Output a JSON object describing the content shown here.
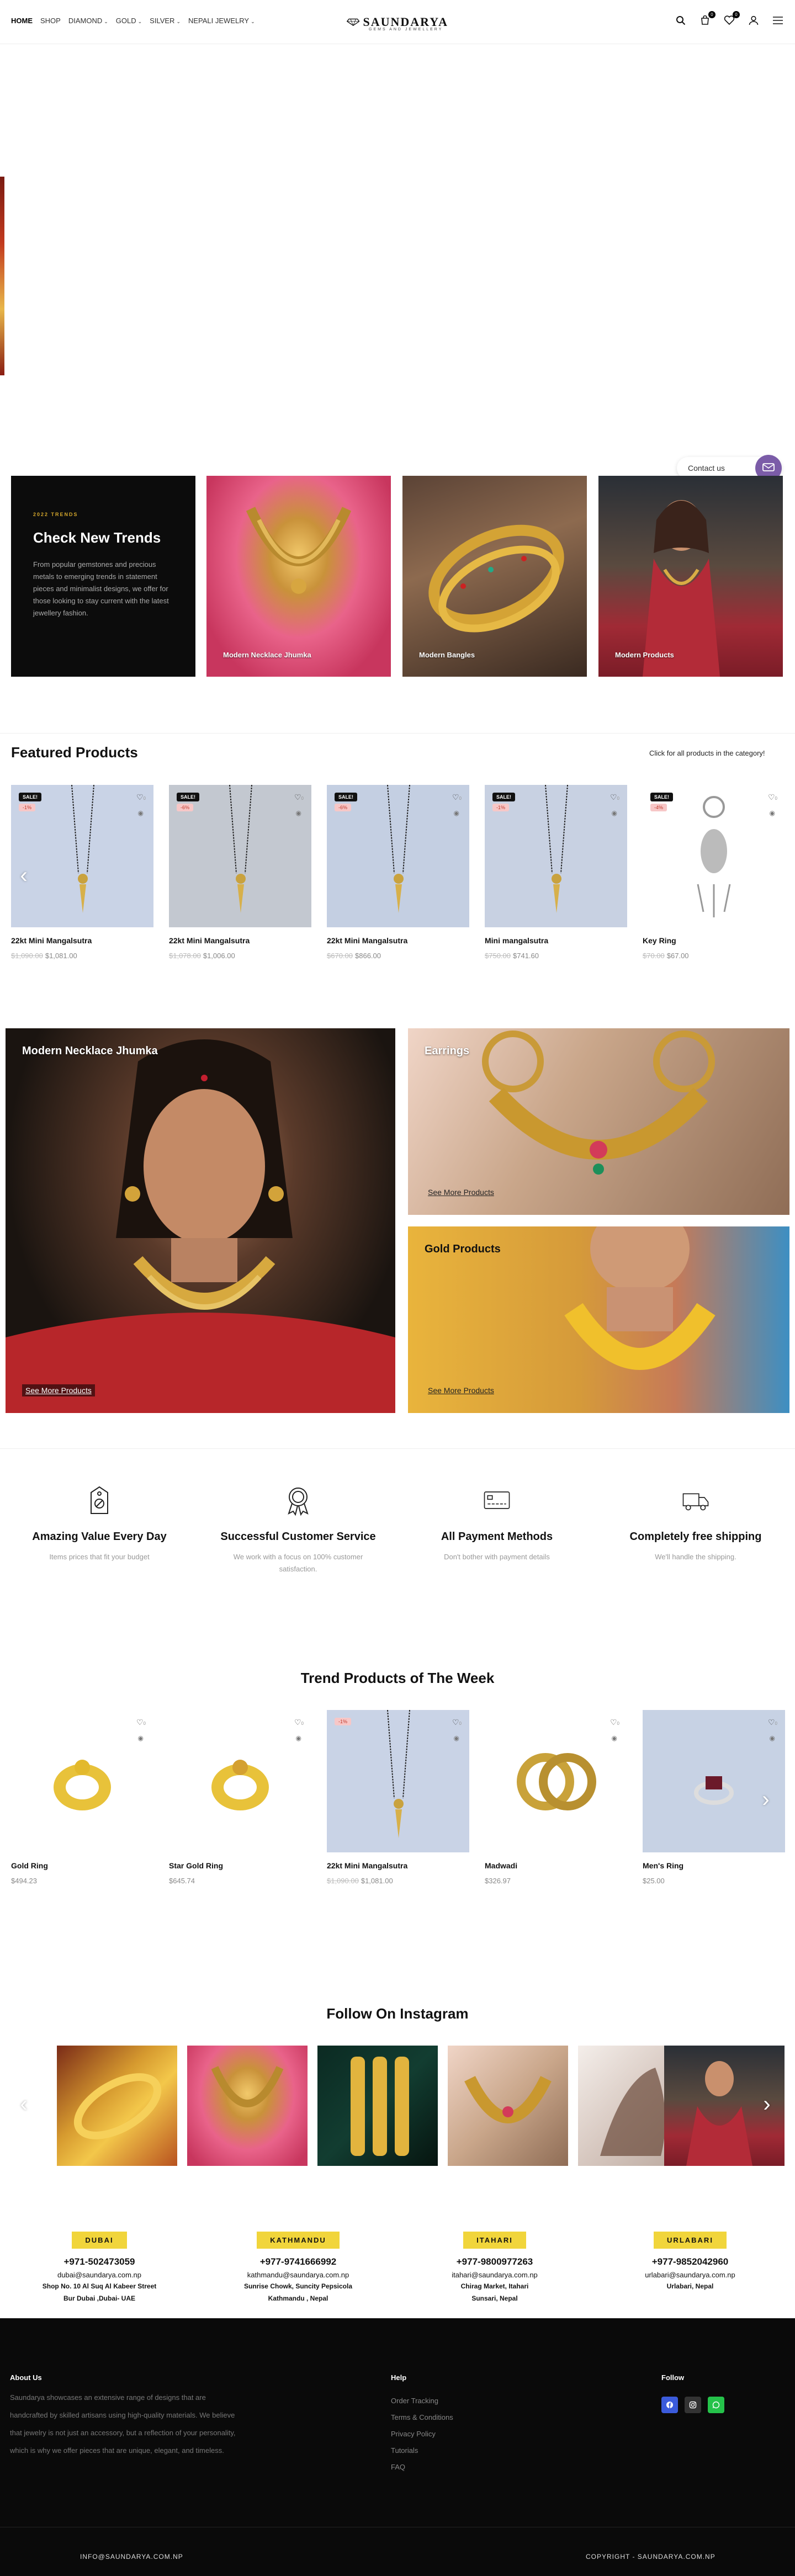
{
  "header": {
    "nav": [
      {
        "label": "HOME",
        "has_dropdown": false,
        "active": true
      },
      {
        "label": "SHOP",
        "has_dropdown": false
      },
      {
        "label": "DIAMOND",
        "has_dropdown": true
      },
      {
        "label": "GOLD",
        "has_dropdown": true
      },
      {
        "label": "SILVER",
        "has_dropdown": true
      },
      {
        "label": "NEPALI JEWELRY",
        "has_dropdown": true
      }
    ],
    "logo_name": "SAUNDARYA",
    "logo_tagline": "GEMS AND JEWELLERY",
    "cart_count": "0",
    "wishlist_count": "0"
  },
  "contact": {
    "label": "Contact us"
  },
  "trends": {
    "tag": "2022 TRENDS",
    "title": "Check New Trends",
    "text": "From popular gemstones and precious metals to emerging trends in statement pieces and minimalist designs, we offer for those looking to stay current with the latest jewellery fashion.",
    "cards": [
      "Modern Necklace Jhumka",
      "Modern Bangles",
      "Modern Products"
    ]
  },
  "featured": {
    "title": "Featured Products",
    "link_text": "Click for all products in the category!",
    "products": [
      {
        "name": "22kt Mini Mangalsutra",
        "old_price": "$1,090.00",
        "price": "$1,081.00",
        "sale": "SALE!",
        "discount": "-1%",
        "wish_count": "0"
      },
      {
        "name": "22kt Mini Mangalsutra",
        "old_price": "$1,078.00",
        "price": "$1,006.00",
        "sale": "SALE!",
        "discount": "-6%",
        "wish_count": "0"
      },
      {
        "name": "22kt Mini Mangalsutra",
        "old_price": "$670.00",
        "price": "$866.00",
        "sale": "SALE!",
        "discount": "-6%",
        "wish_count": "0"
      },
      {
        "name": "Mini mangalsutra",
        "old_price": "$750.00",
        "price": "$741.60",
        "sale": "SALE!",
        "discount": "-1%",
        "wish_count": "0"
      },
      {
        "name": "Key Ring",
        "old_price": "$70.00",
        "price": "$67.00",
        "sale": "SALE!",
        "discount": "-4%",
        "wish_count": "0"
      }
    ]
  },
  "banners": {
    "main_title": "Modern Necklace Jhumka",
    "main_link": "See More Products",
    "earrings_title": "Earrings",
    "earrings_link": "See More Products",
    "gold_title": "Gold Products",
    "gold_link": "See More Products"
  },
  "features": [
    {
      "title": "Amazing Value Every Day",
      "text": "Items prices that fit your budget",
      "icon": "price-tag-icon"
    },
    {
      "title": "Successful Customer Service",
      "text": "We work with a focus on 100% customer satisfaction.",
      "icon": "award-badge-icon"
    },
    {
      "title": "All Payment Methods",
      "text": "Don't bother with payment details",
      "icon": "credit-card-icon"
    },
    {
      "title": "Completely free shipping",
      "text": "We'll handle the shipping.",
      "icon": "delivery-truck-icon"
    }
  ],
  "trend_week": {
    "title": "Trend Products of The Week",
    "products": [
      {
        "name": "Gold Ring",
        "price": "$494.23",
        "old_price": "",
        "wish_count": "0"
      },
      {
        "name": "Star Gold Ring",
        "price": "$645.74",
        "old_price": "",
        "wish_count": "0"
      },
      {
        "name": "22kt Mini Mangalsutra",
        "old_price": "$1,090.00",
        "price": "$1,081.00",
        "discount": "-1%",
        "wish_count": "0"
      },
      {
        "name": "Madwadi",
        "price": "$326.97",
        "old_price": "",
        "wish_count": "0"
      },
      {
        "name": "Men's Ring",
        "price": "$25.00",
        "old_price": "",
        "wish_count": "0"
      }
    ]
  },
  "instagram": {
    "title": "Follow On Instagram"
  },
  "branches": [
    {
      "name": "DUBAI",
      "phone": "+971-502473059",
      "email": "dubai@saundarya.com.np",
      "addr1": "Shop No. 10 Al Suq Al Kabeer Street",
      "addr2": "Bur Dubai ,Dubai- UAE"
    },
    {
      "name": "KATHMANDU",
      "phone": "+977-9741666992",
      "email": "kathmandu@saundarya.com.np",
      "addr1": "Sunrise Chowk, Suncity Pepsicola",
      "addr2": "Kathmandu , Nepal"
    },
    {
      "name": "ITAHARI",
      "phone": "+977-9800977263",
      "email": "itahari@saundarya.com.np",
      "addr1": "Chirag Market, Itahari",
      "addr2": "Sunsari, Nepal"
    },
    {
      "name": "URLABARI",
      "phone": "+977-9852042960",
      "email": "urlabari@saundarya.com.np",
      "addr1": "Urlabari, Nepal",
      "addr2": ""
    }
  ],
  "footer": {
    "about_title": "About Us",
    "about_text": "Saundarya showcases an extensive range of designs that are handcrafted by skilled artisans using high-quality materials. We believe that jewelry is not just an accessory, but a reflection of your personality, which is why we offer pieces that are unique, elegant, and timeless.",
    "help_title": "Help",
    "help_links": [
      "Order Tracking",
      "Terms & Conditions",
      "Privacy Policy",
      "Tutorials",
      "FAQ"
    ],
    "follow_title": "Follow",
    "email": "INFO@SAUNDARYA.COM.NP",
    "copyright": "COPYRIGHT - SAUNDARYA.COM.NP"
  },
  "colors": {
    "accent": "#d4a72c",
    "branch_badge": "#f1d53b",
    "contact": "#7b5ca8",
    "footer_bg": "#0a0a0a"
  }
}
